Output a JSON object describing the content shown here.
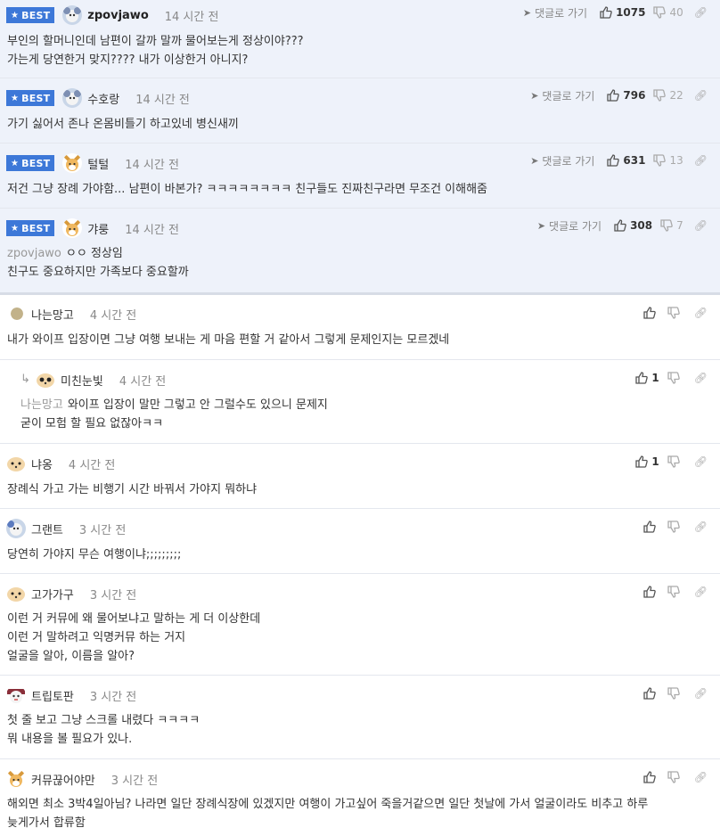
{
  "best_label": "BEST",
  "goto_label": "댓글로 가기",
  "best_comments": [
    {
      "nick": "zpovjawo",
      "time": "14 시간 전",
      "up": "1075",
      "down": "40",
      "lines": [
        "부인의 할머니인데 남편이 갈까 말까 물어보는게 정상이야???",
        "가는게 당연한거 맞지???? 내가 이상한거 아니지?"
      ]
    },
    {
      "nick": "수호랑",
      "time": "14 시간 전",
      "up": "796",
      "down": "22",
      "lines": [
        "가기 싫어서 존나 온몸비틀기 하고있네 병신새끼"
      ]
    },
    {
      "nick": "털털",
      "time": "14 시간 전",
      "up": "631",
      "down": "13",
      "lines": [
        "저건 그냥 장례 가야함... 남편이 바본가? ㅋㅋㅋㅋㅋㅋㅋㅋ 친구들도 진짜친구라면 무조건 이해해줌"
      ]
    },
    {
      "nick": "갸룽",
      "time": "14 시간 전",
      "up": "308",
      "down": "7",
      "mention": "zpovjawo",
      "lines": [
        "ㅇㅇ 정상임",
        "친구도 중요하지만 가족보다 중요할까"
      ]
    }
  ],
  "comments": [
    {
      "nick": "나는망고",
      "time": "4 시간 전",
      "up": "",
      "lines": [
        "내가 와이프 입장이면 그냥 여행 보내는 게 마음 편할 거 같아서 그렇게 문제인지는 모르겠네"
      ]
    },
    {
      "nick": "미친눈빛",
      "time": "4 시간 전",
      "up": "1",
      "mention": "나는망고",
      "lines": [
        "와이프 입장이 말만 그렇고 안 그럴수도 있으니 문제지",
        "굳이 모험 할 필요 없잖아ㅋㅋ"
      ]
    },
    {
      "nick": "냐옹",
      "time": "4 시간 전",
      "up": "1",
      "lines": [
        "장례식 가고 가는 비행기 시간 바꿔서 가야지 뭐하냐"
      ]
    },
    {
      "nick": "그랜트",
      "time": "3 시간 전",
      "up": "",
      "lines": [
        "당연히 가야지 무슨 여행이냐;;;;;;;;;"
      ]
    },
    {
      "nick": "고가가구",
      "time": "3 시간 전",
      "up": "",
      "lines": [
        "이런 거 커뮤에 왜 물어보냐고 말하는 게 더 이상한데",
        "이런 거 말하려고 익명커뮤 하는 거지",
        "얼굴을 알아, 이름을 알아?"
      ]
    },
    {
      "nick": "트립토판",
      "time": "3 시간 전",
      "up": "",
      "lines": [
        "첫 줄 보고 그냥 스크롤 내렸다 ㅋㅋㅋㅋ",
        "뭐 내용을 볼 필요가 있나."
      ]
    },
    {
      "nick": "커뮤끊어야만",
      "time": "3 시간 전",
      "up": "",
      "lines": [
        "해외면 최소 3박4일아님? 나라면 일단 장례식장에 있겠지만 여행이 가고싶어 죽을거같으면 일단 첫날에 가서 얼굴이라도 비추고 하루",
        "늦게가서 합류함"
      ]
    }
  ],
  "icons": {
    "star": "star-icon",
    "goto": "send-arrow-icon",
    "up": "thumbs-up-icon",
    "down": "thumbs-down-icon",
    "link": "link-icon",
    "reply": "reply-arrow-icon"
  },
  "colors": {
    "best_badge": "#3d78d8",
    "best_bg": "#eef2fa"
  }
}
